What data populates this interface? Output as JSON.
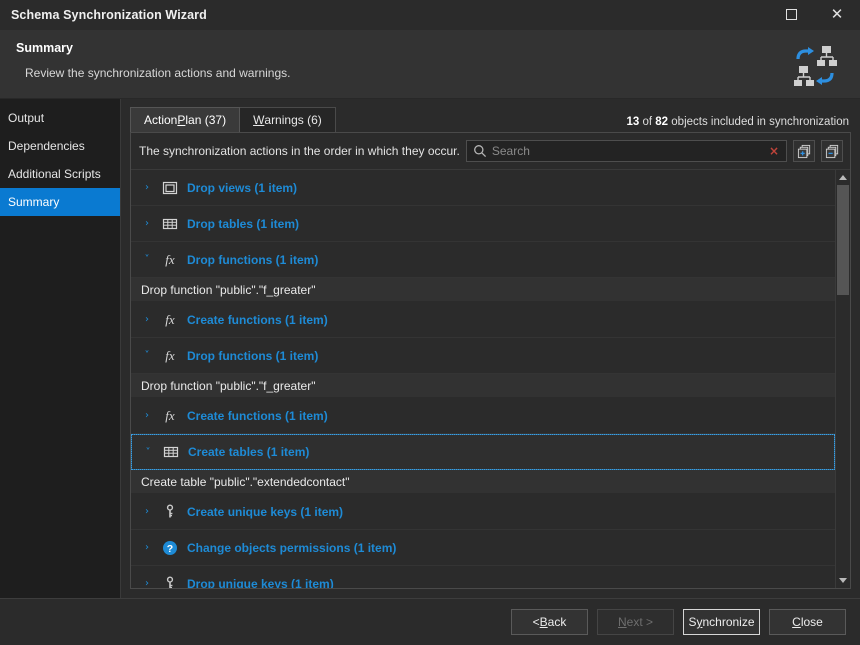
{
  "window": {
    "title": "Schema Synchronization Wizard",
    "maximize_label": "Maximize",
    "close_label": "Close"
  },
  "header": {
    "title": "Summary",
    "subtitle": "Review the synchronization actions and warnings."
  },
  "sidebar": {
    "items": [
      {
        "label": "Output",
        "selected": false
      },
      {
        "label": "Dependencies",
        "selected": false
      },
      {
        "label": "Additional Scripts",
        "selected": false
      },
      {
        "label": "Summary",
        "selected": true
      }
    ]
  },
  "tabs": [
    {
      "label_pre": "Action ",
      "label_accel": "P",
      "label_post": "lan (37)",
      "active": true
    },
    {
      "label_pre": "",
      "label_accel": "W",
      "label_post": "arnings (6)",
      "active": false
    }
  ],
  "counter": {
    "included": "13",
    "of": " of ",
    "total": "82",
    "suffix": " objects included in synchronization"
  },
  "toolbar": {
    "description": "The synchronization actions in the order in which they occur.",
    "search_value": "",
    "search_placeholder": "Search",
    "clear_label": "×",
    "expand_all_label": "Expand all",
    "collapse_all_label": "Collapse all"
  },
  "tree": {
    "rows": [
      {
        "type": "group",
        "expanded": false,
        "icon": "view-icon",
        "label": "Drop views (1 item)",
        "focused": false
      },
      {
        "type": "group",
        "expanded": false,
        "icon": "table-icon",
        "label": "Drop tables (1 item)",
        "focused": false
      },
      {
        "type": "group",
        "expanded": true,
        "icon": "function-icon",
        "label": "Drop functions (1 item)",
        "focused": false
      },
      {
        "type": "child",
        "label": "Drop function \"public\".\"f_greater\""
      },
      {
        "type": "group",
        "expanded": false,
        "icon": "function-icon",
        "label": "Create functions (1 item)",
        "focused": false
      },
      {
        "type": "group",
        "expanded": true,
        "icon": "function-icon",
        "label": "Drop functions (1 item)",
        "focused": false
      },
      {
        "type": "child",
        "label": "Drop function \"public\".\"f_greater\""
      },
      {
        "type": "group",
        "expanded": false,
        "icon": "function-icon",
        "label": "Create functions (1 item)",
        "focused": false
      },
      {
        "type": "group",
        "expanded": true,
        "icon": "table-icon",
        "label": "Create tables (1 item)",
        "focused": true
      },
      {
        "type": "child",
        "label": "Create table \"public\".\"extendedcontact\""
      },
      {
        "type": "group",
        "expanded": false,
        "icon": "key-icon",
        "label": "Create unique keys (1 item)",
        "focused": false
      },
      {
        "type": "group",
        "expanded": false,
        "icon": "permissions-icon",
        "label": "Change objects permissions (1 item)",
        "focused": false
      },
      {
        "type": "group",
        "expanded": false,
        "icon": "key-icon",
        "label": "Drop unique keys (1 item)",
        "focused": false
      }
    ],
    "chevron_collapsed": "›",
    "chevron_expanded": "˅"
  },
  "footer": {
    "buttons": [
      {
        "pre": "< ",
        "accel": "B",
        "post": "ack",
        "state": "normal",
        "name": "back-button"
      },
      {
        "pre": "",
        "accel": "N",
        "post": "ext >",
        "state": "disabled",
        "name": "next-button"
      },
      {
        "pre": "S",
        "accel": "y",
        "post": "nchronize",
        "state": "default",
        "name": "synchronize-button"
      },
      {
        "pre": "",
        "accel": "C",
        "post": "lose",
        "state": "normal",
        "name": "close-button"
      }
    ]
  },
  "colors": {
    "accent": "#1e8bd6",
    "selection": "#0a7ad1",
    "window_bg": "#2b2b2b",
    "sidebar_bg": "#1e1e1e",
    "header_bg": "#333333",
    "clear_red": "#c0443a"
  }
}
